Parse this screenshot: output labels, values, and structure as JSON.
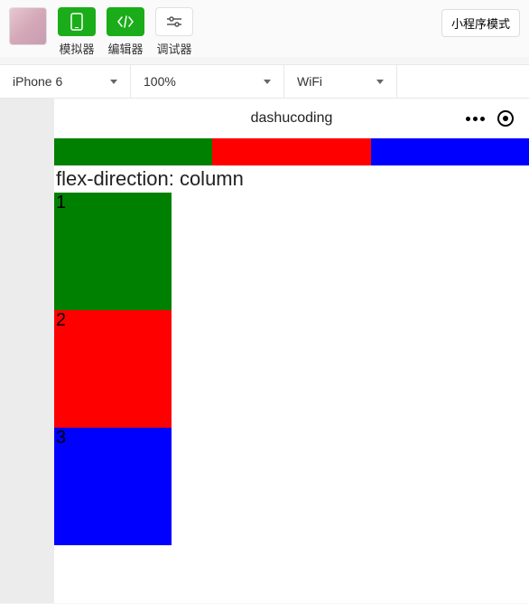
{
  "toolbar": {
    "simulator_label": "模拟器",
    "editor_label": "编辑器",
    "debugger_label": "调试器",
    "mode_label": "小程序模式"
  },
  "dropdowns": {
    "device": "iPhone 6",
    "zoom": "100%",
    "network": "WiFi"
  },
  "preview": {
    "title": "dashucoding",
    "section_label": "flex-direction: column",
    "columns": {
      "item1": "1",
      "item2": "2",
      "item3": "3"
    }
  },
  "colors": {
    "green": "#008000",
    "red": "#ff0000",
    "blue": "#0000ff"
  }
}
